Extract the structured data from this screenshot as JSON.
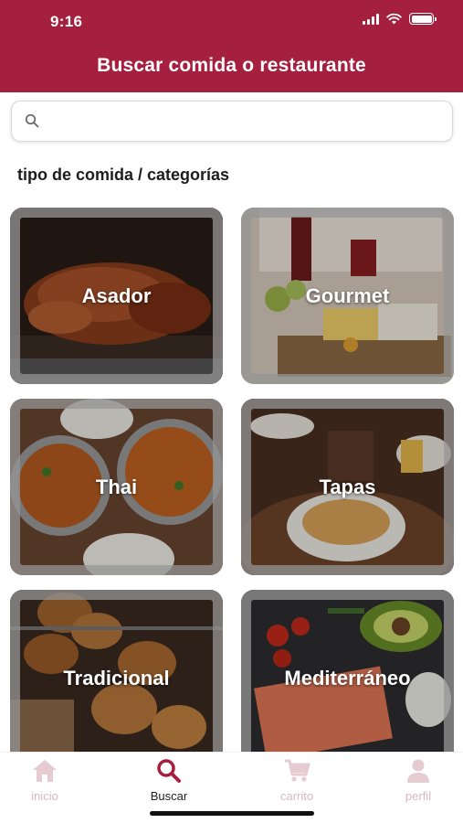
{
  "status_bar": {
    "time": "9:16"
  },
  "header": {
    "title": "Buscar comida o restaurante",
    "color": "#a51f3e"
  },
  "search": {
    "placeholder": "",
    "value": ""
  },
  "section": {
    "title": "tipo de comida / categorías"
  },
  "categories": [
    {
      "label": "Asador",
      "icon": "roast-chicken"
    },
    {
      "label": "Gourmet",
      "icon": "wine-cheese-board"
    },
    {
      "label": "Thai",
      "icon": "curry-bowls"
    },
    {
      "label": "Tapas",
      "icon": "tapas-plate"
    },
    {
      "label": "Tradicional",
      "icon": "croquettes"
    },
    {
      "label": "Mediterráneo",
      "icon": "salmon-avocado"
    }
  ],
  "tabbar": {
    "active_color": "#a51f3e",
    "inactive_color": "#e6cbd2",
    "items": [
      {
        "label": "inicio",
        "icon": "home-icon",
        "active": false
      },
      {
        "label": "Buscar",
        "icon": "search-icon",
        "active": true
      },
      {
        "label": "carrito",
        "icon": "cart-icon",
        "active": false
      },
      {
        "label": "perfil",
        "icon": "user-icon",
        "active": false
      }
    ]
  }
}
